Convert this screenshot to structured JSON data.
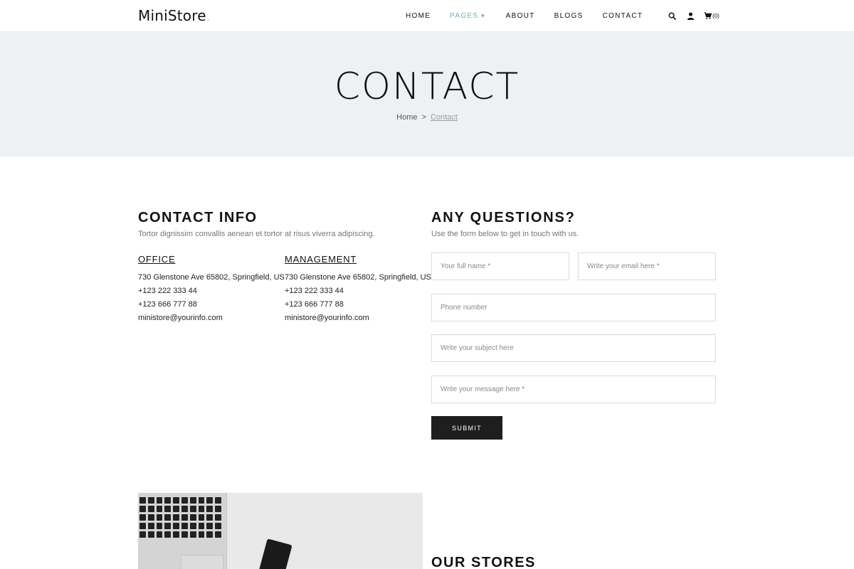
{
  "nav": {
    "logo": "MiniStore",
    "logo_dot": ".",
    "items": [
      {
        "label": "HOME"
      },
      {
        "label": "PAGES"
      },
      {
        "label": "ABOUT"
      },
      {
        "label": "BLOGS"
      },
      {
        "label": "CONTACT"
      }
    ],
    "active_item": "PAGES",
    "cart_count": "(0)",
    "icons": [
      "search-icon",
      "user-icon",
      "cart-icon"
    ],
    "accent_color": "#72aeb0"
  },
  "hero": {
    "title": "CONTACT",
    "breadcrumb": {
      "home": "Home",
      "separator": ">",
      "current": "Contact"
    },
    "background": "#edf1f3"
  },
  "contact_info": {
    "title": "CONTACT INFO",
    "subtitle": "Tortor dignissim convallis aenean et tortor at risus viverra adipiscing.",
    "office": {
      "heading": "OFFICE",
      "address": "730 Glenstone Ave 65802, Springfield, US",
      "phone1": "+123 222 333 44",
      "phone2": "+123 666 777 88",
      "email": "ministore@yourinfo.com"
    },
    "management": {
      "heading": "MANAGEMENT",
      "address": "730 Glenstone Ave 65802, Springfield, US",
      "phone1": "+123 222 333 44",
      "phone2": "+123 666 777 88",
      "email": "ministore@yourinfo.com"
    }
  },
  "form": {
    "title": "ANY QUESTIONS?",
    "subtitle": "Use the form below to get in touch with us.",
    "name_placeholder": "Your full name *",
    "email_placeholder": "Write your email here *",
    "phone_placeholder": "Phone number",
    "subject_placeholder": "Write your subject here",
    "message_placeholder": "Write your message here *",
    "submit_label": "SUBMIT"
  },
  "stores": {
    "title": "OUR STORES"
  }
}
